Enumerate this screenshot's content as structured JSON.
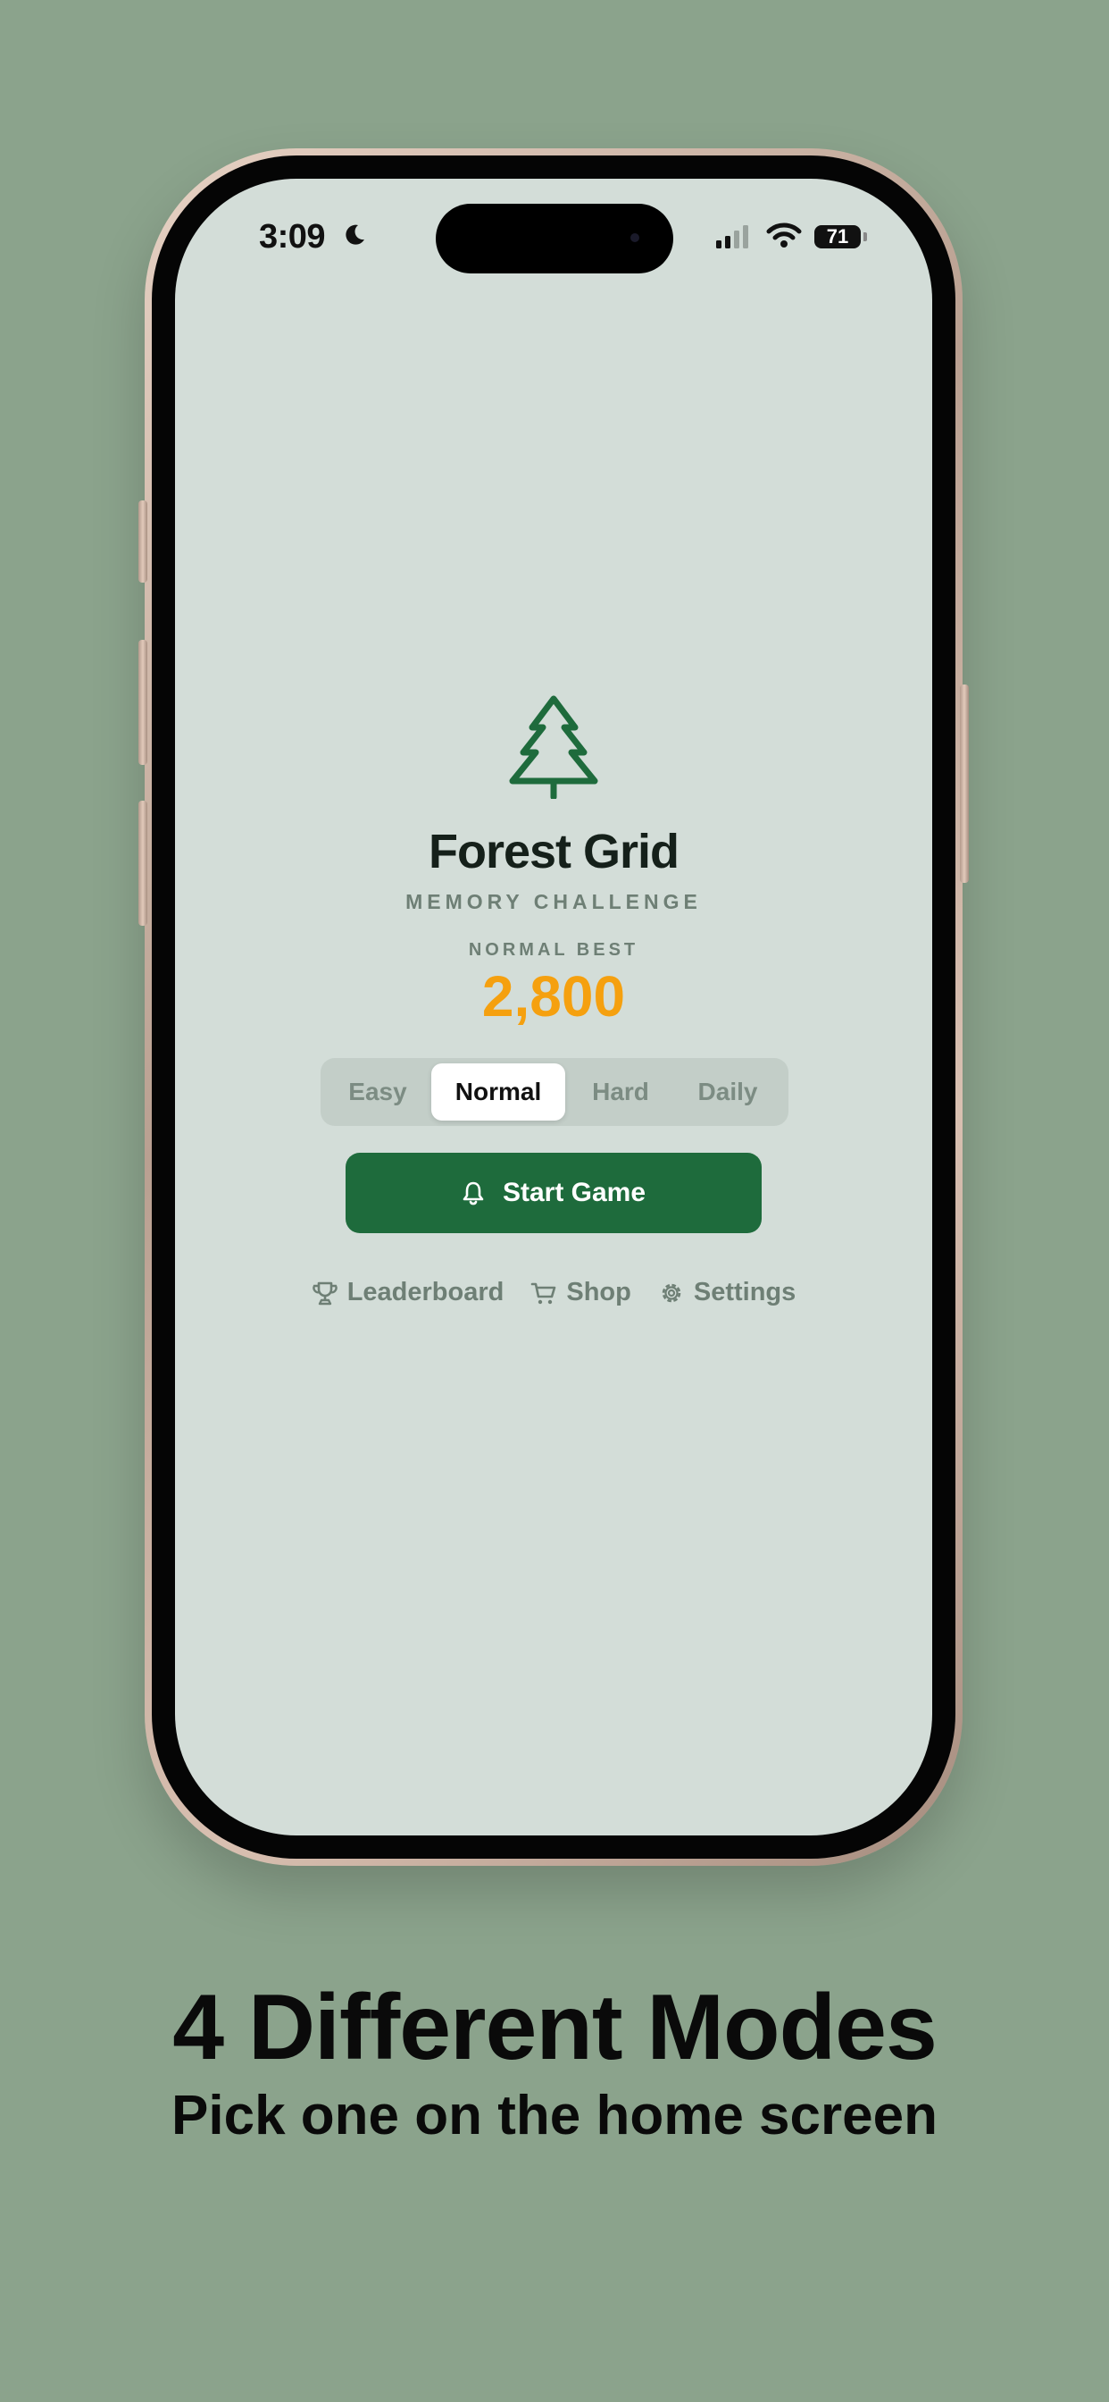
{
  "status_bar": {
    "time": "3:09",
    "battery": "71",
    "icons": [
      "moon-icon",
      "signal-icon",
      "wifi-icon",
      "battery-icon"
    ]
  },
  "app": {
    "logo_icon": "tree-icon",
    "title": "Forest Grid",
    "subtitle": "MEMORY CHALLENGE",
    "best_label": "NORMAL BEST",
    "best_score": "2,800",
    "modes": [
      {
        "label": "Easy",
        "selected": false
      },
      {
        "label": "Normal",
        "selected": true
      },
      {
        "label": "Hard",
        "selected": false
      },
      {
        "label": "Daily",
        "selected": false
      }
    ],
    "start_button": {
      "label": "Start Game",
      "icon": "bell-icon"
    },
    "links": [
      {
        "label": "Leaderboard",
        "icon": "trophy-icon"
      },
      {
        "label": "Shop",
        "icon": "cart-icon"
      },
      {
        "label": "Settings",
        "icon": "gear-icon"
      }
    ]
  },
  "caption": {
    "title": "4 Different Modes",
    "subtitle": "Pick one on the home screen"
  },
  "colors": {
    "background": "#8ba38c",
    "screen": "#d3ddd8",
    "brand_green": "#1e6b3c",
    "score_orange": "#f5a00f",
    "muted_text": "#6e7f75"
  }
}
